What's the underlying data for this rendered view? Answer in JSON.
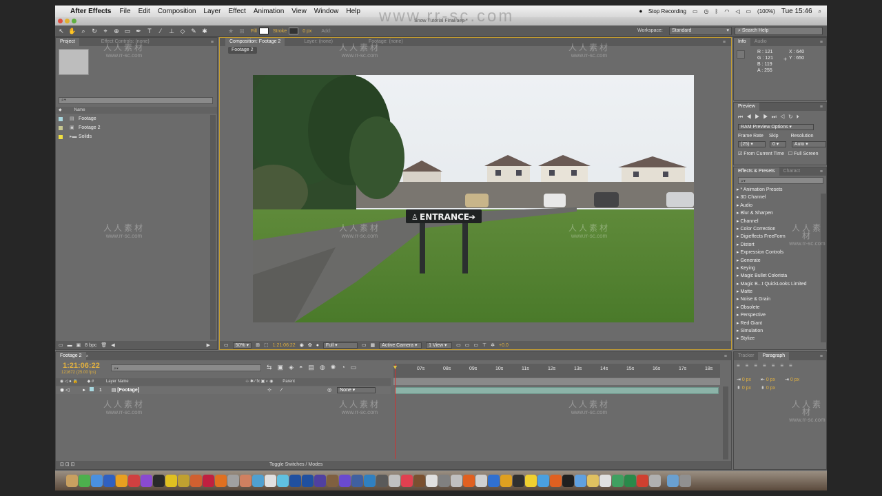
{
  "menubar": {
    "app_name": "After Effects",
    "items": [
      "File",
      "Edit",
      "Composition",
      "Layer",
      "Effect",
      "Animation",
      "View",
      "Window",
      "Help"
    ],
    "stop_recording": "Stop Recording",
    "battery": "(100%)",
    "clock": "Tue 15:46"
  },
  "window_title": "Snow Tutorial Final.aep *",
  "toolbar": {
    "fill_label": "Fill",
    "stroke_label": "Stroke",
    "stroke_width": "0 px",
    "add_label": "Add:",
    "workspace_label": "Workspace:",
    "workspace_value": "Standard",
    "search_help": "Search Help"
  },
  "project_panel": {
    "tabs": [
      "Project",
      "Effect Controls: (none)"
    ],
    "column_name": "Name",
    "items": [
      {
        "name": "Footage",
        "label_color": "#a8d8e0"
      },
      {
        "name": "Footage 2",
        "label_color": "#c8c890"
      },
      {
        "name": "Solids",
        "label_color": "#f0e040"
      }
    ],
    "bpc": "8 bpc"
  },
  "composition_panel": {
    "tabs": [
      "Composition: Footage 2",
      "Layer: (none)",
      "Footage: (none)"
    ],
    "sub_tab": "Footage 2",
    "sign_text": "ENTRANCE",
    "zoom": "50%",
    "timecode": "1:21:06:22",
    "resolution": "Full",
    "camera": "Active Camera",
    "views": "1 View",
    "exposure": "+0.0"
  },
  "info_panel": {
    "tabs": [
      "Info",
      "Audio"
    ],
    "r": "R : 121",
    "g": "G : 121",
    "b": "B : 119",
    "a": "A : 255",
    "x": "X : 640",
    "y": "Y : 650"
  },
  "preview_panel": {
    "tab": "Preview",
    "ram_options": "RAM Preview Options",
    "frame_rate_label": "Frame Rate",
    "skip_label": "Skip",
    "resolution_label": "Resolution",
    "frame_rate": "(25)",
    "skip": "0",
    "resolution": "Auto",
    "from_current": "From Current Time",
    "full_screen": "Full Screen"
  },
  "effects_panel": {
    "tabs": [
      "Effects & Presets",
      "Charact"
    ],
    "items": [
      "* Animation Presets",
      "3D Channel",
      "Audio",
      "Blur & Sharpen",
      "Channel",
      "Color Correction",
      "Digieffects FreeForm",
      "Distort",
      "Expression Controls",
      "Generate",
      "Keying",
      "Magic Bullet Colorista",
      "Magic B...t QuickLooks Limited",
      "Matte",
      "Noise & Grain",
      "Obsolete",
      "Perspective",
      "Red Giant",
      "Simulation",
      "Stylize"
    ]
  },
  "timeline": {
    "tab": "Footage 2",
    "timecode": "1:21:06:22",
    "frames": "121672 (25.00 fps)",
    "col_layer_name": "Layer Name",
    "col_parent": "Parent",
    "layer_number": "1",
    "layer_name": "[Footage]",
    "parent_value": "None",
    "ruler": [
      "07s",
      "08s",
      "09s",
      "10s",
      "11s",
      "12s",
      "13s",
      "14s",
      "15s",
      "16s",
      "17s",
      "18s"
    ],
    "toggle_label": "Toggle Switches / Modes"
  },
  "right_bottom": {
    "tabs": [
      "Tracker",
      "Paragraph"
    ],
    "values": [
      "0 px",
      "0 px",
      "0 px",
      "0 px",
      "0 px"
    ]
  },
  "watermark": {
    "top": "www.rr-sc.com",
    "cn": "人人素材",
    "url": "www.rr-sc.com"
  }
}
